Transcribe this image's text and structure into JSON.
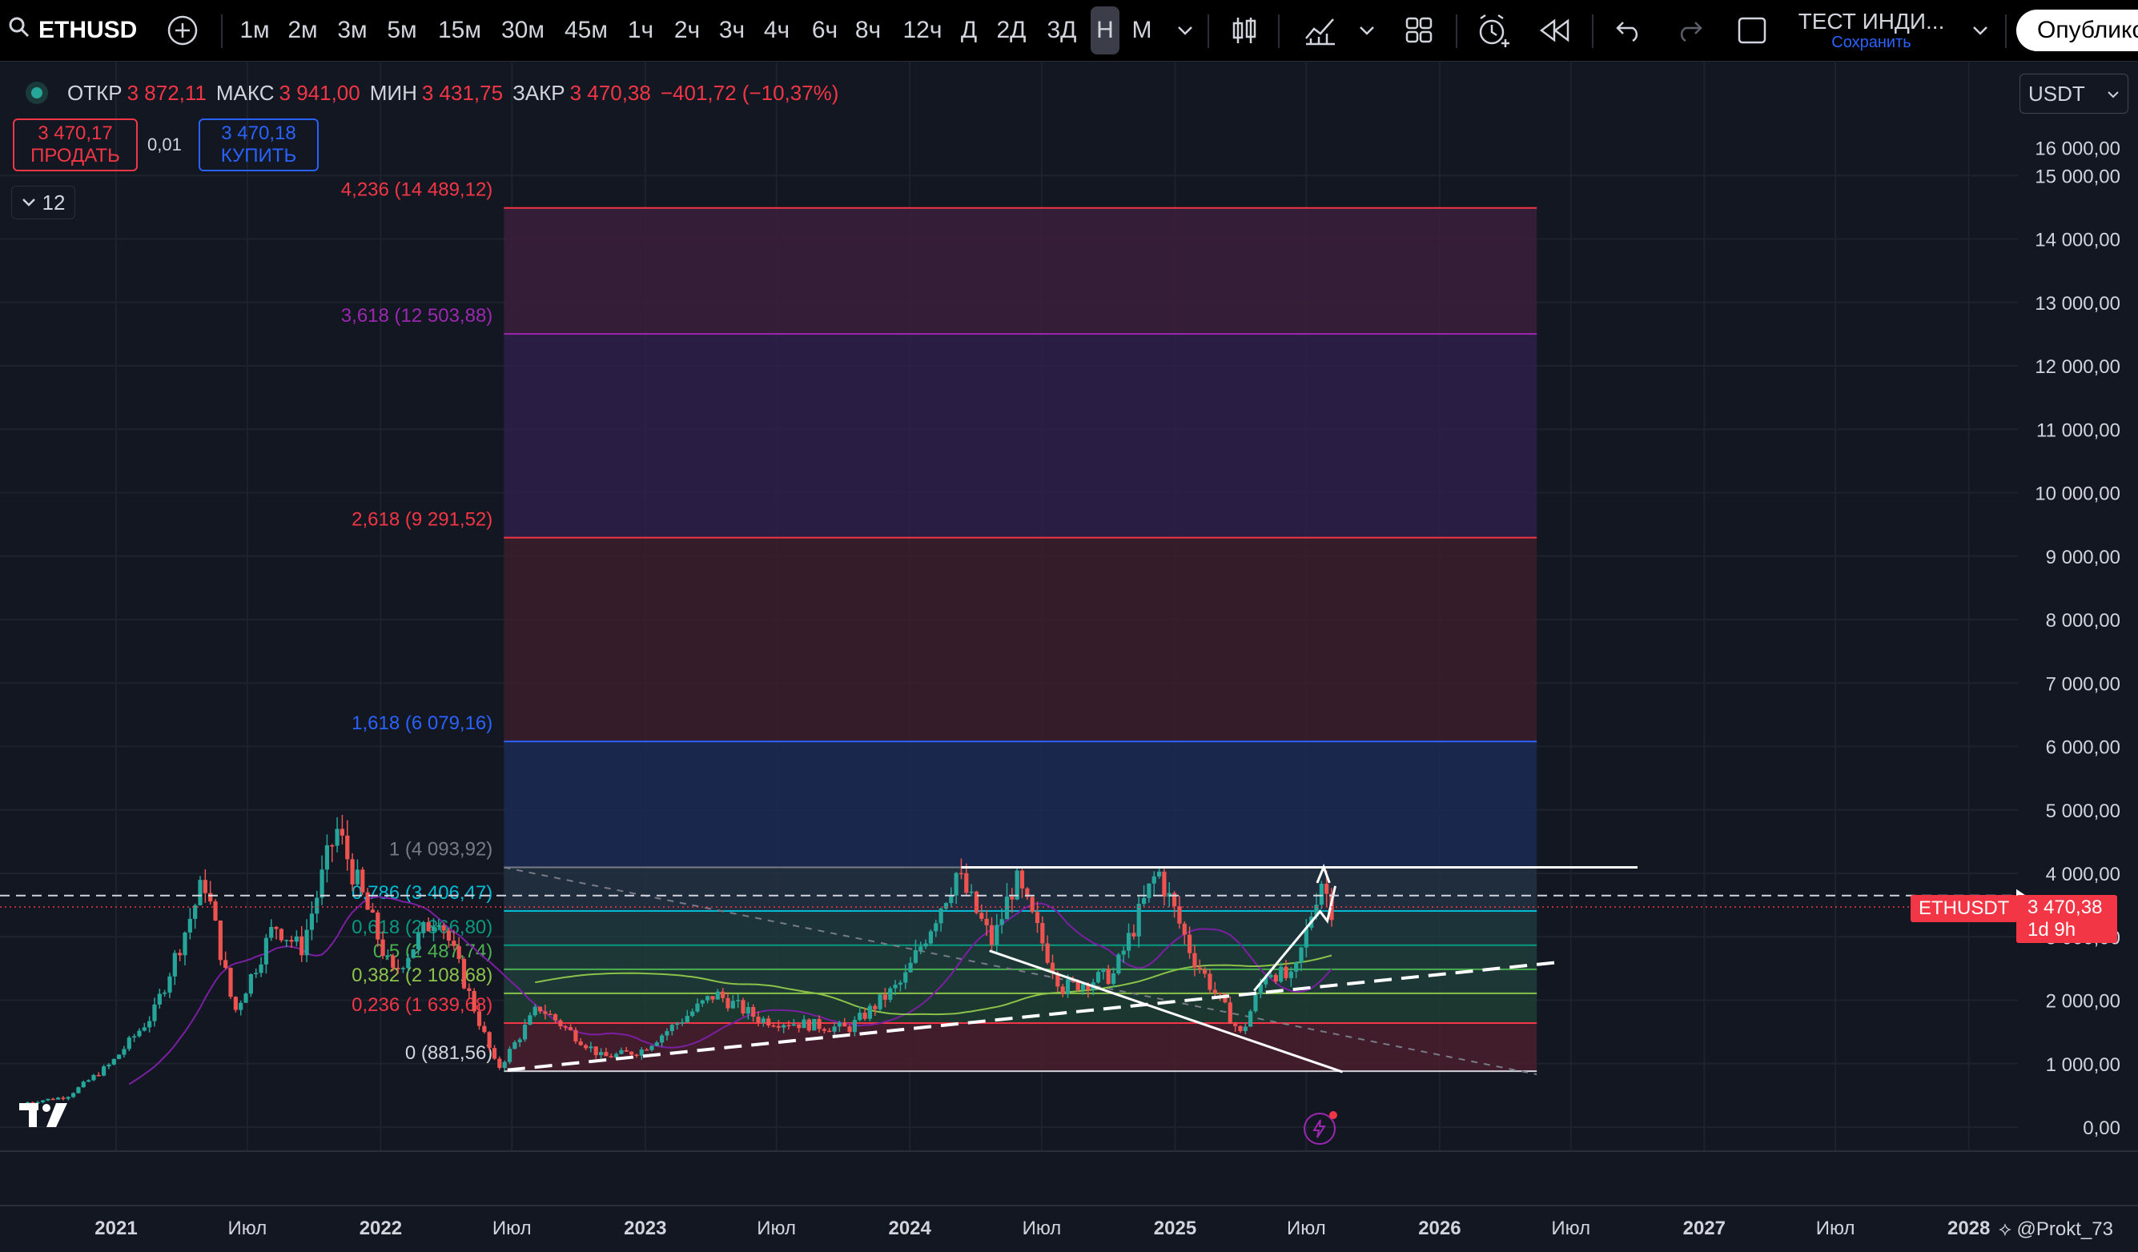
{
  "toolbar": {
    "symbol": "ETHUSD",
    "intervals": [
      "1м",
      "2м",
      "3м",
      "5м",
      "15м",
      "30м",
      "45м",
      "1ч",
      "2ч",
      "3ч",
      "4ч",
      "6ч",
      "8ч",
      "12ч",
      "Д",
      "2Д",
      "3Д",
      "Н",
      "М"
    ],
    "active_interval": "Н",
    "layout_name": "ТЕСТ ИНДИ...",
    "save_label": "Сохранить",
    "publish_label": "Опублико"
  },
  "legend": {
    "open_label": "ОТКР",
    "open_value": "3 872,11",
    "high_label": "МАКС",
    "high_value": "3 941,00",
    "low_label": "МИН",
    "low_value": "3 431,75",
    "close_label": "ЗАКР",
    "close_value": "3 470,38",
    "change": "−401,72 (−10,37%)"
  },
  "trade": {
    "sell_price": "3 470,17",
    "sell_label": "ПРОДАТЬ",
    "spread": "0,01",
    "buy_price": "3 470,18",
    "buy_label": "КУПИТЬ"
  },
  "indicators_collapsed_count": "12",
  "currency": "USDT",
  "last_price_tag": {
    "symbol": "ETHUSDT",
    "price": "3 470,38",
    "countdown": "1d 9h"
  },
  "watermark": "@Prokt_73",
  "colors": {
    "up": "#26a69a",
    "down": "#ef5350",
    "fib_red": "#f23645",
    "fib_purple": "#9c27b0",
    "fib_blue": "#2962ff",
    "ma_purple": "#7b1fa2",
    "ma_green": "#8bc34a"
  },
  "chart_data": {
    "type": "candlestick",
    "symbol": "ETHUSD",
    "timeframe": "1W",
    "y_range": [
      0,
      15500
    ],
    "y_ticks": [
      0,
      1000,
      2000,
      3000,
      4000,
      5000,
      6000,
      7000,
      8000,
      9000,
      10000,
      11000,
      12000,
      13000,
      14000,
      15000
    ],
    "y_tick_labels": [
      "0,00",
      "1 000,00",
      "2 000,00",
      "3 000,00",
      "4 000,00",
      "5 000,00",
      "6 000,00",
      "7 000,00",
      "8 000,00",
      "9 000,00",
      "10 000,00",
      "11 000,00",
      "12 000,00",
      "13 000,00",
      "14 000,00",
      "15 000,00"
    ],
    "x_range": [
      "2020-09-01",
      "2028-05-01"
    ],
    "x_ticks": [
      "2021-01-01",
      "2021-07-01",
      "2022-01-01",
      "2022-07-01",
      "2023-01-01",
      "2023-07-01",
      "2024-01-01",
      "2024-07-01",
      "2025-01-01",
      "2025-07-01",
      "2026-01-01",
      "2026-07-01",
      "2027-01-01",
      "2027-07-01",
      "2028-01-01"
    ],
    "x_tick_labels": [
      "2021",
      "Июл",
      "2022",
      "Июл",
      "2023",
      "Июл",
      "2024",
      "Июл",
      "2025",
      "Июл",
      "2026",
      "Июл",
      "2027",
      "Июл",
      "2028"
    ],
    "price_path": [
      [
        "2020-09-01",
        380
      ],
      [
        "2020-11-01",
        480
      ],
      [
        "2021-01-01",
        1000
      ],
      [
        "2021-03-01",
        1800
      ],
      [
        "2021-05-10",
        3900
      ],
      [
        "2021-06-20",
        1800
      ],
      [
        "2021-08-15",
        3200
      ],
      [
        "2021-09-20",
        2800
      ],
      [
        "2021-11-08",
        4700
      ],
      [
        "2022-01-24",
        2400
      ],
      [
        "2022-03-28",
        3400
      ],
      [
        "2022-06-18",
        900
      ],
      [
        "2022-08-14",
        1900
      ],
      [
        "2022-11-10",
        1100
      ],
      [
        "2023-01-01",
        1200
      ],
      [
        "2023-04-15",
        2100
      ],
      [
        "2023-06-15",
        1700
      ],
      [
        "2023-10-15",
        1550
      ],
      [
        "2023-12-30",
        2300
      ],
      [
        "2024-03-12",
        4000
      ],
      [
        "2024-05-01",
        2900
      ],
      [
        "2024-06-01",
        3900
      ],
      [
        "2024-08-05",
        2200
      ],
      [
        "2024-10-15",
        2400
      ],
      [
        "2024-12-15",
        4050
      ],
      [
        "2025-02-01",
        2700
      ],
      [
        "2025-04-09",
        1450
      ],
      [
        "2025-05-15",
        2500
      ],
      [
        "2025-06-20",
        2300
      ],
      [
        "2025-07-28",
        3940
      ],
      [
        "2025-08-11",
        3470
      ]
    ],
    "fib_levels": [
      {
        "ratio": "0",
        "price": 881.56,
        "label": "0 (881,56)",
        "color": "#d1d4dc"
      },
      {
        "ratio": "0,236",
        "price": 1639.68,
        "label": "0,236 (1 639,68)",
        "color": "#f23645"
      },
      {
        "ratio": "0,382",
        "price": 2108.68,
        "label": "0,382 (2 108,68)",
        "color": "#8bc34a"
      },
      {
        "ratio": "0,5",
        "price": 2487.74,
        "label": "0,5 (2 487,74)",
        "color": "#4caf50"
      },
      {
        "ratio": "0,618",
        "price": 2866.8,
        "label": "0,618 (2 866,80)",
        "color": "#089981"
      },
      {
        "ratio": "0,786",
        "price": 3406.47,
        "label": "0,786 (3 406,47)",
        "color": "#00bcd4"
      },
      {
        "ratio": "1",
        "price": 4093.92,
        "label": "1 (4 093,92)",
        "color": "#787b86"
      },
      {
        "ratio": "1,618",
        "price": 6079.16,
        "label": "1,618 (6 079,16)",
        "color": "#2962ff"
      },
      {
        "ratio": "2,618",
        "price": 9291.52,
        "label": "2,618 (9 291,52)",
        "color": "#f23645"
      },
      {
        "ratio": "3,618",
        "price": 12503.88,
        "label": "3,618 (12 503,88)",
        "color": "#9c27b0"
      },
      {
        "ratio": "4,236",
        "price": 14489.12,
        "label": "4,236 (14 489,12)",
        "color": "#f23645"
      }
    ],
    "fib_time_range": [
      "2022-06-20",
      "2026-05-15"
    ],
    "current_price": 3470.38,
    "ma_slow_start": "2021-05-01",
    "ma_fast_start": "2021-01-01"
  }
}
